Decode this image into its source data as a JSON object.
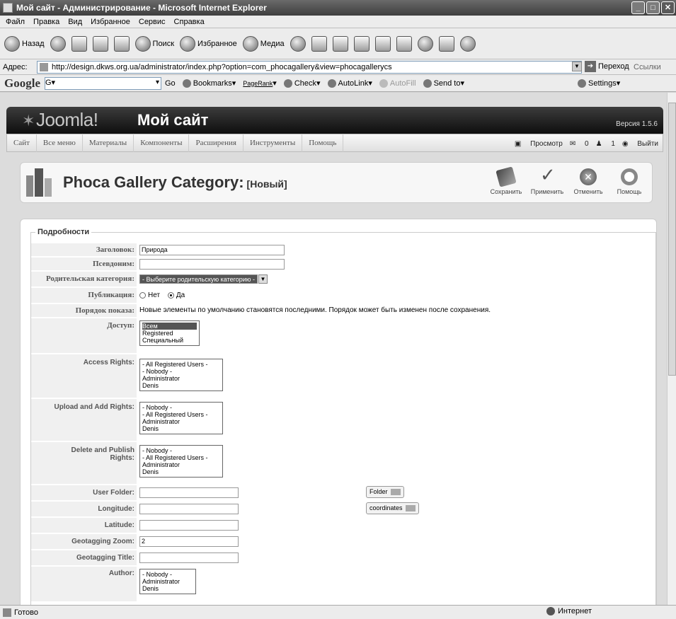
{
  "window": {
    "title": "Мой сайт - Администрирование - Microsoft Internet Explorer"
  },
  "menubar": [
    "Файл",
    "Правка",
    "Вид",
    "Избранное",
    "Сервис",
    "Справка"
  ],
  "toolbar": {
    "back": "Назад",
    "search": "Поиск",
    "favorites": "Избранное",
    "media": "Медиа"
  },
  "address": {
    "label": "Адрес:",
    "url": "http://design.dkws.org.ua/administrator/index.php?option=com_phocagallery&view=phocagallerycs",
    "go": "Переход",
    "links": "Ссылки"
  },
  "google": {
    "logo": "Google",
    "search_value": "G▾",
    "go": "Go",
    "bookmarks": "Bookmarks",
    "pagerank": "PageRank",
    "check": "Check",
    "autolink": "AutoLink",
    "autofill": "AutoFill",
    "sendto": "Send to",
    "settings": "Settings"
  },
  "joomla": {
    "logo": "Joomla!",
    "site_name": "Мой сайт",
    "version": "Версия 1.5.6",
    "menu": [
      "Сайт",
      "Все меню",
      "Материалы",
      "Компоненты",
      "Расширения",
      "Инструменты",
      "Помощь"
    ],
    "right": {
      "preview": "Просмотр",
      "messages": "0",
      "users": "1",
      "logout": "Выйти"
    },
    "page_title": "Phoca Gallery Category:",
    "page_sub": "[Новый]",
    "buttons": {
      "save": "Сохранить",
      "apply": "Применить",
      "cancel": "Отменить",
      "help": "Помощь"
    }
  },
  "form": {
    "legend": "Подробности",
    "title_label": "Заголовок:",
    "title_value": "Природа",
    "alias_label": "Псевдоним:",
    "alias_value": "",
    "parent_label": "Родительская категория:",
    "parent_value": "- Выберите родительскую категорию -",
    "published_label": "Публикация:",
    "published_no": "Нет",
    "published_yes": "Да",
    "order_label": "Порядок показа:",
    "order_text": "Новые элементы по умолчанию становятся последними. Порядок может быть изменен после сохранения.",
    "access_label": "Доступ:",
    "access_options": [
      "Всем",
      "Registered",
      "Специальный"
    ],
    "access_rights_label": "Access Rights:",
    "access_rights_options": [
      "- All Registered Users -",
      "- Nobody -",
      "Administrator",
      "Denis"
    ],
    "upload_label": "Upload and Add Rights:",
    "upload_options": [
      "- Nobody -",
      "- All Registered Users -",
      "Administrator",
      "Denis"
    ],
    "delete_label_1": "Delete and Publish",
    "delete_label_2": "Rights:",
    "delete_options": [
      "- Nobody -",
      "- All Registered Users -",
      "Administrator",
      "Denis"
    ],
    "user_folder_label": "User Folder:",
    "folder_btn": "Folder",
    "longitude_label": "Longitude:",
    "coordinates_btn": "coordinates",
    "latitude_label": "Latitude:",
    "zoom_label": "Geotagging Zoom:",
    "zoom_value": "2",
    "geotitle_label": "Geotagging Title:",
    "author_label": "Author:",
    "author_options": [
      "- Nobody -",
      "Administrator",
      "Denis"
    ]
  },
  "status": {
    "text": "Готово",
    "zone": "Интернет"
  }
}
